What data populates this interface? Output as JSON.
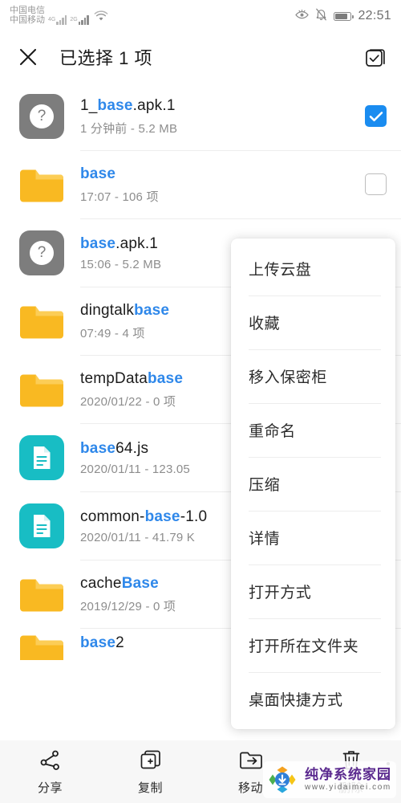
{
  "statusbar": {
    "carrier_top": "中国电信",
    "carrier_bottom": "中国移动",
    "net_label_1": "4G",
    "net_label_2": "2G",
    "wifi_icon": "wifi-icon",
    "eye_icon": "eye-comfort-icon",
    "bell_icon": "bell-muted-icon",
    "battery_icon": "battery-icon",
    "time": "22:51"
  },
  "appbar": {
    "close_icon": "close-icon",
    "title": "已选择 1 项",
    "select_all_icon": "select-all-icon"
  },
  "files": [
    {
      "icon": "unknown-file-icon",
      "icon_type": "unknown",
      "name_pre": "1_",
      "name_hl": "base",
      "name_post": ".apk.1",
      "info": "1 分钟前 - 5.2 MB",
      "checked": true
    },
    {
      "icon": "folder-icon",
      "icon_type": "folder",
      "name_pre": "",
      "name_hl": "base",
      "name_post": "",
      "info": "17:07 - 106 项",
      "checked": false
    },
    {
      "icon": "unknown-file-icon",
      "icon_type": "unknown",
      "name_pre": "",
      "name_hl": "base",
      "name_post": ".apk.1",
      "info": "15:06 - 5.2 MB",
      "checked": false
    },
    {
      "icon": "folder-icon",
      "icon_type": "folder",
      "name_pre": "dingtalk",
      "name_hl": "base",
      "name_post": "",
      "info": "07:49 - 4 项",
      "checked": false
    },
    {
      "icon": "folder-icon",
      "icon_type": "folder",
      "name_pre": "tempData",
      "name_hl": "base",
      "name_post": "",
      "info": "2020/01/22 - 0 项",
      "checked": false
    },
    {
      "icon": "document-file-icon",
      "icon_type": "doc",
      "name_pre": "",
      "name_hl": "base",
      "name_post": "64.js",
      "info": "2020/01/11 - 123.05",
      "checked": false
    },
    {
      "icon": "document-file-icon",
      "icon_type": "doc",
      "name_pre": "common-",
      "name_hl": "base",
      "name_post": "-1.0",
      "info": "2020/01/11 - 41.79 K",
      "checked": false
    },
    {
      "icon": "folder-icon",
      "icon_type": "folder",
      "name_pre": "cache",
      "name_hl": "Base",
      "name_post": "",
      "info": "2019/12/29 - 0 项",
      "checked": false
    },
    {
      "icon": "folder-icon",
      "icon_type": "folder",
      "name_pre": "",
      "name_hl": "base",
      "name_post": "2",
      "info": "",
      "checked": false
    }
  ],
  "menu": {
    "items": [
      "上传云盘",
      "收藏",
      "移入保密柜",
      "重命名",
      "压缩",
      "详情",
      "打开方式",
      "打开所在文件夹",
      "桌面快捷方式"
    ]
  },
  "toolbar": {
    "items": [
      {
        "icon": "share-icon",
        "label": "分享"
      },
      {
        "icon": "copy-icon",
        "label": "复制"
      },
      {
        "icon": "move-icon",
        "label": "移动"
      },
      {
        "icon": "delete-icon",
        "label": "删除"
      }
    ],
    "more_icon": "more-vertical-icon"
  },
  "watermark": {
    "title": "纯净系统家园",
    "url": "www.yidaimei.com"
  },
  "colors": {
    "accent_blue": "#2f88ea",
    "checkbox_blue": "#1a8cf0",
    "folder_yellow": "#f9b922",
    "doc_teal": "#18bdc4",
    "unknown_gray": "#7d7d7d",
    "toolbar_bg": "#f7f7f7"
  }
}
